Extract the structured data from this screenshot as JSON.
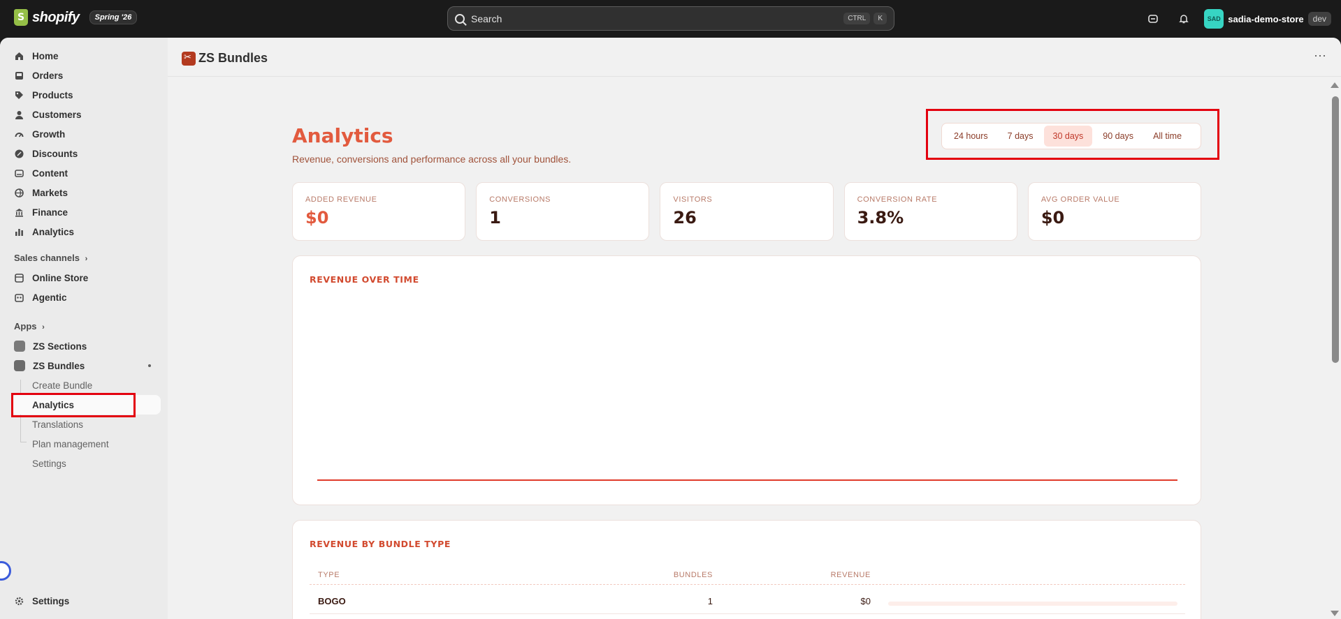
{
  "topbar": {
    "logo_text": "shopify",
    "edition": "Spring '26",
    "search_placeholder": "Search",
    "kbd_ctrl": "CTRL",
    "kbd_k": "K",
    "store_initials": "SAD",
    "store_name": "sadia-demo-store",
    "store_env": "dev"
  },
  "sidebar": {
    "items": [
      {
        "label": "Home",
        "icon": "home-icon"
      },
      {
        "label": "Orders",
        "icon": "inbox-icon"
      },
      {
        "label": "Products",
        "icon": "tag-icon"
      },
      {
        "label": "Customers",
        "icon": "person-icon"
      },
      {
        "label": "Growth",
        "icon": "gauge-icon"
      },
      {
        "label": "Discounts",
        "icon": "discount-icon"
      },
      {
        "label": "Content",
        "icon": "image-icon"
      },
      {
        "label": "Markets",
        "icon": "globe-icon"
      },
      {
        "label": "Finance",
        "icon": "bank-icon"
      },
      {
        "label": "Analytics",
        "icon": "bar-chart-icon"
      }
    ],
    "sales_channels_title": "Sales channels",
    "sales_channels": [
      {
        "label": "Online Store",
        "icon": "store-icon"
      },
      {
        "label": "Agentic",
        "icon": "robot-icon"
      }
    ],
    "apps_title": "Apps",
    "apps": [
      {
        "label": "ZS Sections"
      },
      {
        "label": "ZS Bundles"
      }
    ],
    "app_subitems": [
      {
        "label": "Create Bundle"
      },
      {
        "label": "Analytics"
      },
      {
        "label": "Translations"
      },
      {
        "label": "Plan management"
      },
      {
        "label": "Settings"
      }
    ],
    "settings_label": "Settings"
  },
  "header": {
    "app_title": "ZS Bundles",
    "more_label": "⋯"
  },
  "analytics": {
    "title": "Analytics",
    "subtitle": "Revenue, conversions and performance across all your bundles.",
    "ranges": [
      "24 hours",
      "7 days",
      "30 days",
      "90 days",
      "All time"
    ],
    "selected_range": "30 days"
  },
  "kpis": [
    {
      "label": "ADDED REVENUE",
      "value": "$0"
    },
    {
      "label": "CONVERSIONS",
      "value": "1"
    },
    {
      "label": "VISITORS",
      "value": "26"
    },
    {
      "label": "CONVERSION RATE",
      "value": "3.8%"
    },
    {
      "label": "AVG ORDER VALUE",
      "value": "$0"
    }
  ],
  "revenue_card": {
    "title": "REVENUE OVER TIME"
  },
  "bundle_type_card": {
    "title": "REVENUE BY BUNDLE TYPE",
    "columns": [
      "TYPE",
      "BUNDLES",
      "REVENUE"
    ],
    "rows": [
      {
        "type": "BOGO",
        "bundles": "1",
        "revenue": "$0",
        "share": 0
      }
    ]
  },
  "colors": {
    "accent": "#e25a3e",
    "highlight_box": "#e3000f",
    "line": "#e03c2a"
  },
  "chart_data": {
    "type": "line",
    "title": "REVENUE OVER TIME",
    "series": [
      {
        "values": [
          0,
          0,
          0,
          0,
          0,
          0,
          0,
          0,
          0,
          0,
          0,
          0,
          0,
          0,
          0,
          0,
          0,
          0,
          0,
          0,
          0,
          0,
          0,
          0,
          0,
          0,
          0,
          0,
          0,
          0
        ]
      }
    ],
    "grid": false
  }
}
